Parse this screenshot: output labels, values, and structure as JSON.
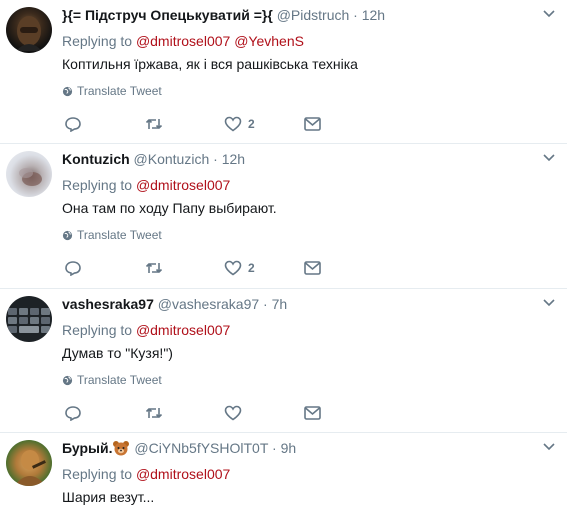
{
  "tweets": [
    {
      "display_name": "}{= Підструч Опецькуватий =}{",
      "handle": "@Pidstruch",
      "separator": "·",
      "time": "12h",
      "replying_label": "Replying to",
      "mentions": [
        "@dmitrosel007",
        "@YevhenS"
      ],
      "text": "Коптильня їржава, як і вся рашківська техніка",
      "translate_label": "Translate Tweet",
      "likes": "2"
    },
    {
      "display_name": "Kontuzich",
      "handle": "@Kontuzich",
      "separator": "·",
      "time": "12h",
      "replying_label": "Replying to",
      "mentions": [
        "@dmitrosel007"
      ],
      "text": "Она там по ходу Папу выбирают.",
      "translate_label": "Translate Tweet",
      "likes": "2"
    },
    {
      "display_name": "vashesraka97",
      "handle": "@vashesraka97",
      "separator": "·",
      "time": "7h",
      "replying_label": "Replying to",
      "mentions": [
        "@dmitrosel007"
      ],
      "text": "Думав то \"Кузя!\")",
      "translate_label": "Translate Tweet",
      "likes": ""
    },
    {
      "display_name": "Бурый.",
      "handle": "@CiYNb5fYSHOlT0T",
      "separator": "·",
      "time": "9h",
      "replying_label": "Replying to",
      "mentions": [
        "@dmitrosel007"
      ],
      "text": "Шария везут...",
      "emoji": "bear-face-icon"
    }
  ],
  "colors": {
    "mention": "#b0101a",
    "secondary_text": "#657786",
    "divider": "#e6ecf0",
    "icon": "#657786"
  },
  "icons": [
    "reply-icon",
    "retweet-icon",
    "like-icon",
    "direct-message-icon",
    "globe-icon",
    "chevron-down-icon"
  ]
}
